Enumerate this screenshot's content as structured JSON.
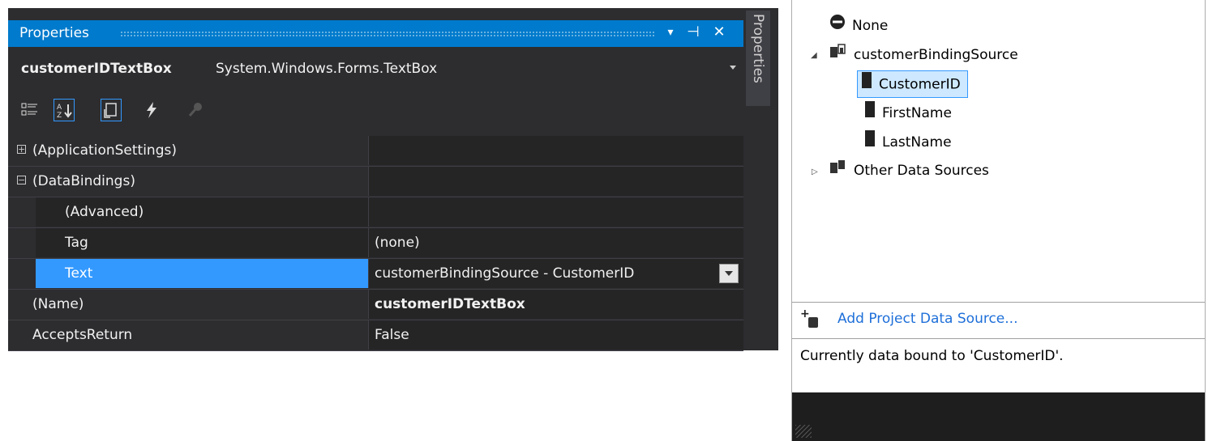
{
  "properties_window": {
    "title": "Properties",
    "side_tab": "Properties",
    "controls": {
      "dropdown": "▾",
      "pin": "⊣",
      "close": "✕"
    },
    "object": {
      "name": "customerIDTextBox",
      "type": "System.Windows.Forms.TextBox"
    },
    "toolbar": [
      "categorized-icon",
      "alphabetical-icon",
      "properties-icon",
      "events-icon",
      "property-pages-icon"
    ],
    "rows": [
      {
        "name": "(ApplicationSettings)",
        "value": "",
        "expander": "+"
      },
      {
        "name": "(DataBindings)",
        "value": "",
        "expander": "−"
      },
      {
        "name": "(Advanced)",
        "value": ""
      },
      {
        "name": "Tag",
        "value": "(none)"
      },
      {
        "name": "Text",
        "value": "customerBindingSource - CustomerID"
      },
      {
        "name": "(Name)",
        "value": "customerIDTextBox"
      },
      {
        "name": "AcceptsReturn",
        "value": "False"
      }
    ],
    "colors": {
      "accent": "#007acc",
      "selection": "#3399ff",
      "background": "#2d2d30"
    }
  },
  "binding_picker": {
    "items": {
      "none": "None",
      "source": "customerBindingSource",
      "fields": [
        "CustomerID",
        "FirstName",
        "LastName"
      ],
      "other": "Other Data Sources"
    },
    "add_link": "Add Project Data Source...",
    "status": "Currently data bound to 'CustomerID'."
  }
}
